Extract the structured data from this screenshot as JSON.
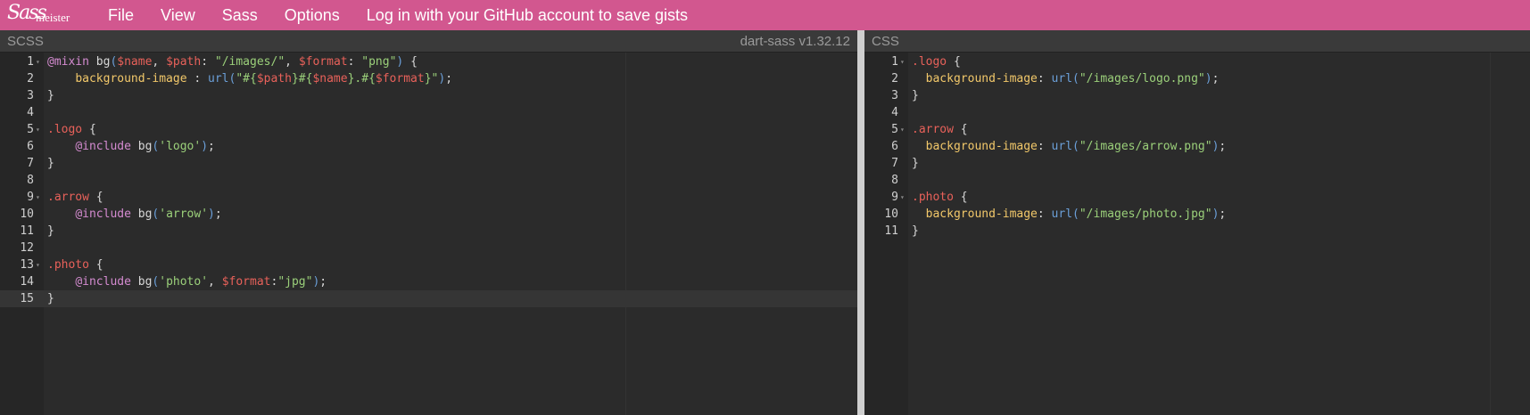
{
  "app": {
    "logo_script": "Sass",
    "logo_word": "meister"
  },
  "menu": {
    "items": [
      "File",
      "View",
      "Sass",
      "Options",
      "Log in with your GitHub account to save gists"
    ]
  },
  "left_panel": {
    "title": "SCSS",
    "compiler": "dart-sass v1.32.12",
    "active_line": 15
  },
  "right_panel": {
    "title": "CSS"
  },
  "scss_lines": [
    "@mixin bg($name, $path: \"/images/\", $format: \"png\") {",
    "    background-image : url(\"#{$path}#{$name}.#{$format}\");",
    "}",
    "",
    ".logo {",
    "    @include bg('logo');",
    "}",
    "",
    ".arrow {",
    "    @include bg('arrow');",
    "}",
    "",
    ".photo {",
    "    @include bg('photo', $format:\"jpg\");",
    "}"
  ],
  "css_lines": [
    ".logo {",
    "  background-image: url(\"/images/logo.png\");",
    "}",
    "",
    ".arrow {",
    "  background-image: url(\"/images/arrow.png\");",
    "}",
    "",
    ".photo {",
    "  background-image: url(\"/images/photo.jpg\");",
    "}"
  ],
  "colors": {
    "topbar": "#d2578f",
    "keyword": "#d48bd0",
    "variable": "#e8615a",
    "string": "#9bd07a",
    "property": "#f2c86a",
    "function": "#6b9fd8"
  }
}
